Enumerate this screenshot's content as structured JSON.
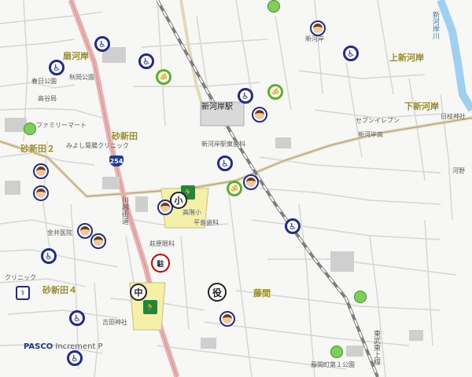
{
  "map": {
    "areas": {
      "ogikawagishi": "扇河岸",
      "sunashinden": "砂新田",
      "kamishinkawagishi": "上新河岸",
      "shimoshinkawagishi": "下新河岸",
      "fujima": "藤間",
      "sunashinden4": "砂新田４",
      "sunashinden2": "砂新田２"
    },
    "stations": {
      "shingashi": "新河岸駅",
      "shingashi_bridge": "新河岸"
    },
    "places": {
      "kasuga_park": "春日公園",
      "akiba_park": "秋岡公園",
      "takaya": "高谷局",
      "family_mart": "ファミリーマート",
      "miyoshi_clinic": "みよし胃腸クリニック",
      "kanai_clinic": "金井医院",
      "kosaka_school": "高階小",
      "shingashi_dental": "新河岸駅東歯科",
      "heima_dental": "平島歯科",
      "hagihara_eye": "萩原眼科",
      "yoshida_shrine": "吉田神社",
      "fujima_park": "藤間町第１公園",
      "seven_eleven": "セブンイレブン",
      "hie_shrine": "日枝神社",
      "kawano": "河野",
      "shinkawagishi_high": "新河岸高",
      "clinic": "クリニック",
      "shinkawa_tsuki": "新河岸川",
      "kawagoe": "川越街道",
      "toujou_line": "東武東上線"
    },
    "route_shield": "254",
    "icons": {
      "town_office": "役",
      "junior_high": "中",
      "school_mark": "小",
      "no_parking": "駐"
    }
  },
  "attribution": {
    "logo": "PASCO",
    "product": "Increment P"
  },
  "colors": {
    "road": "#c8c8c8",
    "major_road": "#b7a07a",
    "rail": "#7d7d7d",
    "river": "#9ed0f0",
    "school_area": "#f4f0a8",
    "area_label": "#9a8a1a",
    "wheelchair": "#1f2c8c",
    "bike": "#5bb323"
  }
}
